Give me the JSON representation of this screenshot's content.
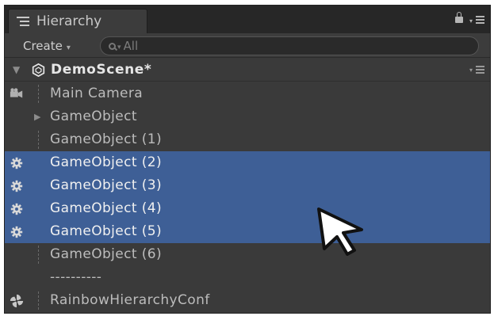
{
  "window": {
    "tab_label": "Hierarchy",
    "tab_icon": "hierarchy-list-icon",
    "lock_icon": "lock-icon",
    "menu_icon": "panel-menu-icon"
  },
  "toolbar": {
    "create_label": "Create",
    "create_arrow": "▾",
    "search_placeholder": "All",
    "search_value": ""
  },
  "scene": {
    "name": "DemoScene*",
    "icon": "unity-logo-icon",
    "expand_icon": "triangle-down-icon"
  },
  "rows": [
    {
      "label": "Main Camera",
      "icon": "camera-icon",
      "selected": false,
      "expandable": false
    },
    {
      "label": "GameObject",
      "icon": "",
      "selected": false,
      "expandable": true
    },
    {
      "label": "GameObject (1)",
      "icon": "",
      "selected": false,
      "expandable": false
    },
    {
      "label": "GameObject (2)",
      "icon": "gear-icon",
      "selected": true,
      "expandable": false
    },
    {
      "label": "GameObject (3)",
      "icon": "gear-icon",
      "selected": true,
      "expandable": false
    },
    {
      "label": "GameObject (4)",
      "icon": "gear-icon",
      "selected": true,
      "expandable": false
    },
    {
      "label": "GameObject (5)",
      "icon": "gear-icon",
      "selected": true,
      "expandable": false
    },
    {
      "label": "GameObject (6)",
      "icon": "",
      "selected": false,
      "expandable": false
    },
    {
      "label": "----------",
      "icon": "",
      "selected": false,
      "expandable": false
    },
    {
      "label": "RainbowHierarchyConf",
      "icon": "pinwheel-icon",
      "selected": false,
      "expandable": false
    }
  ],
  "colors": {
    "selection": "#3e5f96",
    "panel_bg": "#3a3a3a",
    "text": "#bcbcbc"
  },
  "cursor_icon": "mouse-pointer-icon"
}
